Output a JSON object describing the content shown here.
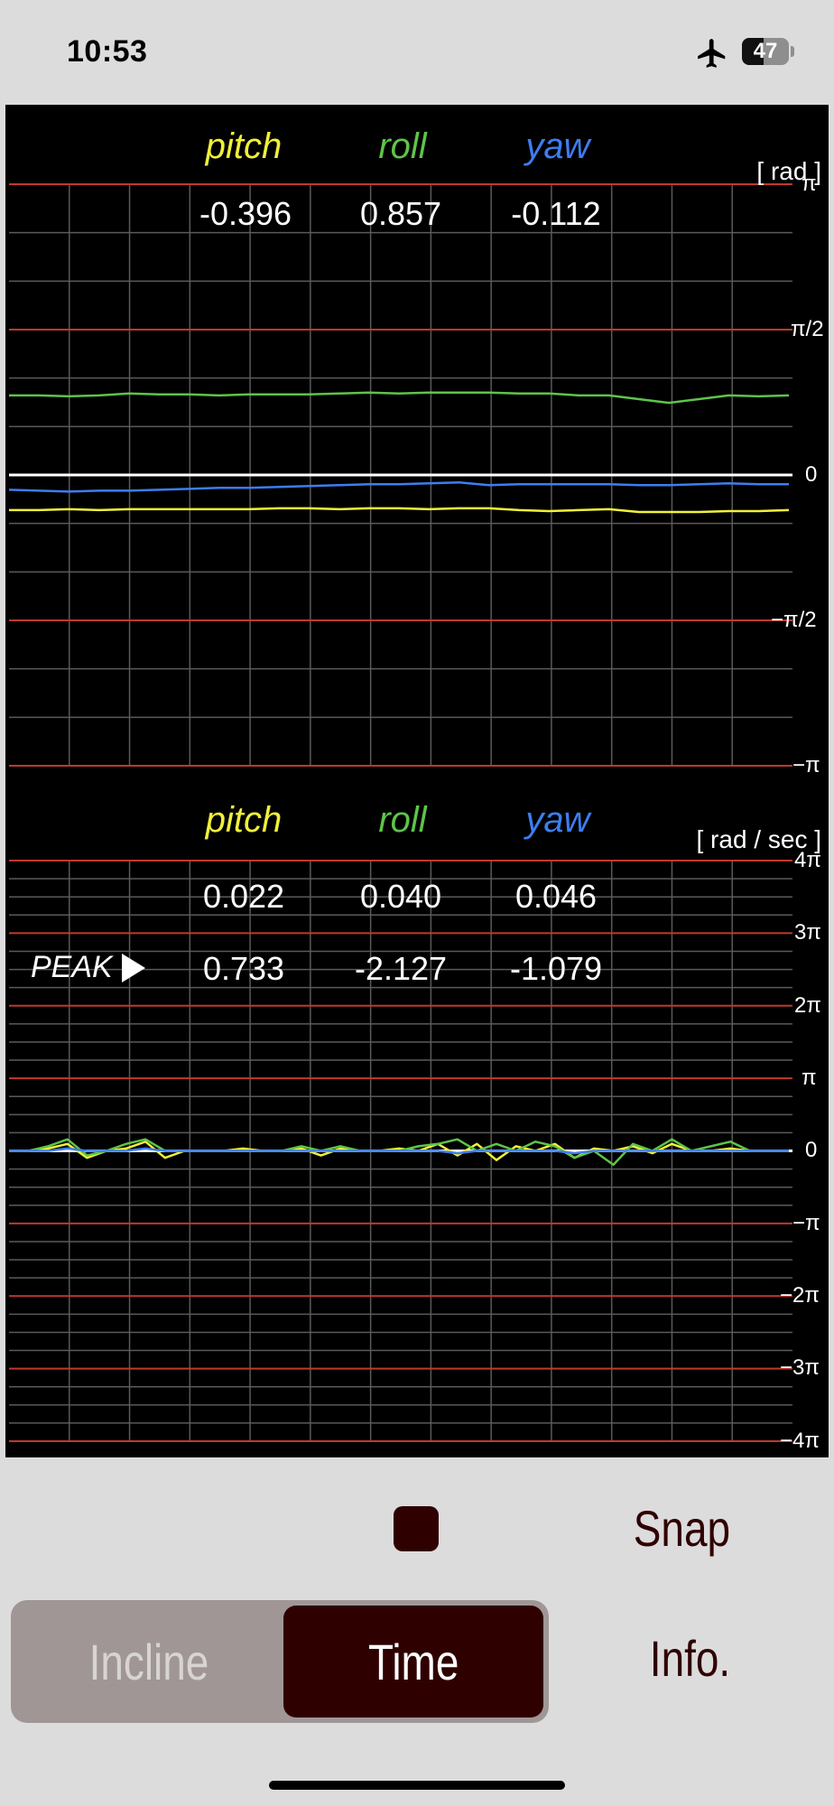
{
  "status_bar": {
    "time": "10:53",
    "battery": "47",
    "icons": [
      "airplane-icon",
      "battery-icon"
    ]
  },
  "colors": {
    "pitch": "#f0f03a",
    "roll": "#5ec449",
    "yaw": "#3d7df0",
    "major_grid": "#c0392b",
    "minor_grid": "#5a5a5a",
    "zero_line": "#ffffff"
  },
  "attitude": {
    "labels": {
      "pitch": "pitch",
      "roll": "roll",
      "yaw": "yaw"
    },
    "unit": "[ rad ]",
    "values": {
      "pitch": "-0.396",
      "roll": "0.857",
      "yaw": "-0.112"
    },
    "ticks": [
      "π",
      "π/2",
      "0",
      "−π/2",
      "−π"
    ]
  },
  "rate": {
    "labels": {
      "pitch": "pitch",
      "roll": "roll",
      "yaw": "yaw"
    },
    "unit": "[ rad / sec ]",
    "values": {
      "pitch": "0.022",
      "roll": "0.040",
      "yaw": "0.046"
    },
    "peak_label": "PEAK",
    "peak": {
      "pitch": "0.733",
      "roll": "-2.127",
      "yaw": "-1.079"
    },
    "ticks": [
      "4π",
      "3π",
      "2π",
      "π",
      "0",
      "−π",
      "−2π",
      "−3π",
      "−4π"
    ]
  },
  "chart_data": [
    {
      "type": "line",
      "ylabel": "[ rad ]",
      "ylim": [
        -3.1416,
        3.1416
      ],
      "grid": true,
      "x": [
        0,
        1,
        2,
        3,
        4,
        5,
        6,
        7,
        8,
        9,
        10,
        11,
        12,
        13,
        14,
        15,
        16,
        17,
        18,
        19,
        20,
        21,
        22,
        23,
        24,
        25,
        26
      ],
      "series": [
        {
          "name": "roll",
          "values": [
            0.86,
            0.86,
            0.85,
            0.86,
            0.88,
            0.87,
            0.87,
            0.86,
            0.87,
            0.87,
            0.87,
            0.88,
            0.89,
            0.88,
            0.89,
            0.89,
            0.89,
            0.88,
            0.88,
            0.86,
            0.86,
            0.82,
            0.78,
            0.82,
            0.86,
            0.85,
            0.86
          ]
        },
        {
          "name": "yaw",
          "values": [
            -0.16,
            -0.17,
            -0.18,
            -0.17,
            -0.17,
            -0.16,
            -0.15,
            -0.14,
            -0.14,
            -0.13,
            -0.12,
            -0.11,
            -0.1,
            -0.1,
            -0.09,
            -0.08,
            -0.11,
            -0.1,
            -0.1,
            -0.1,
            -0.1,
            -0.11,
            -0.11,
            -0.1,
            -0.09,
            -0.1,
            -0.1
          ]
        },
        {
          "name": "pitch",
          "values": [
            -0.38,
            -0.38,
            -0.37,
            -0.38,
            -0.37,
            -0.37,
            -0.37,
            -0.37,
            -0.37,
            -0.36,
            -0.36,
            -0.37,
            -0.36,
            -0.36,
            -0.37,
            -0.36,
            -0.36,
            -0.38,
            -0.39,
            -0.38,
            -0.37,
            -0.4,
            -0.4,
            -0.4,
            -0.39,
            -0.39,
            -0.38
          ]
        }
      ]
    },
    {
      "type": "line",
      "ylabel": "[ rad / sec ]",
      "ylim": [
        -12.566,
        12.566
      ],
      "grid": true,
      "x": [
        0,
        1,
        2,
        3,
        4,
        5,
        6,
        7,
        8,
        9,
        10,
        11,
        12,
        13,
        14,
        15,
        16,
        17,
        18,
        19,
        20,
        21,
        22,
        23,
        24,
        25,
        26,
        27,
        28,
        29,
        30,
        31,
        32,
        33,
        34,
        35,
        36,
        37,
        38,
        39,
        40
      ],
      "series": [
        {
          "name": "pitch",
          "values": [
            0,
            0,
            0.1,
            0.3,
            -0.3,
            0,
            0.1,
            0.4,
            -0.3,
            0,
            0,
            0,
            0.1,
            0,
            0,
            0.1,
            -0.2,
            0.1,
            0,
            0,
            0.1,
            0,
            0.3,
            -0.2,
            0.3,
            -0.4,
            0.2,
            0,
            0.3,
            -0.3,
            0.1,
            0,
            0.2,
            -0.1,
            0.3,
            0,
            0,
            0.1,
            0,
            0,
            0
          ]
        },
        {
          "name": "roll",
          "values": [
            0,
            0,
            0.2,
            0.5,
            -0.2,
            0,
            0.3,
            0.5,
            0,
            0,
            0,
            0,
            0,
            0,
            0,
            0.2,
            0,
            0.2,
            0,
            0,
            0,
            0.2,
            0.3,
            0.5,
            0,
            0.3,
            0,
            0.4,
            0.2,
            -0.3,
            0,
            -0.6,
            0.3,
            0,
            0.5,
            0,
            0.2,
            0.4,
            0,
            0,
            0
          ]
        },
        {
          "name": "yaw",
          "values": [
            0,
            0,
            0,
            0.1,
            0,
            0,
            0,
            0.1,
            0,
            0,
            0,
            0,
            0,
            0,
            0,
            0,
            0,
            0,
            0,
            0,
            0,
            0,
            0,
            -0.1,
            0,
            0,
            0,
            0,
            0,
            -0.1,
            0,
            0,
            0,
            0,
            0,
            0,
            0,
            0,
            0,
            0,
            0
          ]
        }
      ]
    }
  ],
  "controls": {
    "snap_label": "Snap",
    "info_label": "Info.",
    "segments": [
      "Incline",
      "Time"
    ],
    "selected_segment": "Time"
  }
}
